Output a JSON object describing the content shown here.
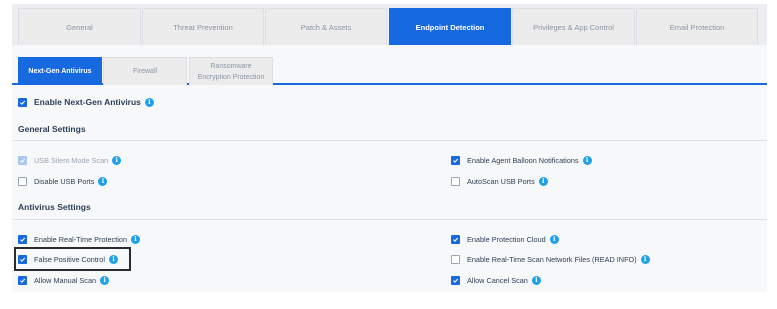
{
  "main_tabs": [
    {
      "label": "General",
      "active": false
    },
    {
      "label": "Threat Prevention",
      "active": false
    },
    {
      "label": "Patch & Assets",
      "active": false
    },
    {
      "label": "Endpoint Detection",
      "active": true
    },
    {
      "label": "Privileges & App Control",
      "active": false
    },
    {
      "label": "Email Protection",
      "active": false
    }
  ],
  "sub_tabs": [
    {
      "label": "Next-Gen Antivirus",
      "active": true
    },
    {
      "label": "Firewall",
      "active": false
    },
    {
      "label": "Ransomware Encryption Protection",
      "active": false
    }
  ],
  "enable_ngav": {
    "label": "Enable Next-Gen Antivirus",
    "checked": true
  },
  "general_settings": {
    "title": "General Settings",
    "left": [
      {
        "label": "USB Silent Mode Scan",
        "checked": true,
        "disabled": true
      },
      {
        "label": "Disable USB Ports",
        "checked": false
      }
    ],
    "right": [
      {
        "label": "Enable Agent Balloon Notifications",
        "checked": true
      },
      {
        "label": "AutoScan USB Ports",
        "checked": false
      }
    ]
  },
  "antivirus_settings": {
    "title": "Antivirus Settings",
    "left": [
      {
        "label": "Enable Real-Time Protection",
        "checked": true
      },
      {
        "label": "False Positive Control",
        "checked": true
      },
      {
        "label": "Allow Manual Scan",
        "checked": true
      }
    ],
    "right": [
      {
        "label": "Enable Protection Cloud",
        "checked": true
      },
      {
        "label": "Enable Real-Time Scan Network Files (READ INFO)",
        "checked": false
      },
      {
        "label": "Allow Cancel Scan",
        "checked": true
      }
    ]
  },
  "colors": {
    "accent": "#1769e0",
    "info": "#1fa0e8",
    "highlight_border": "#2b2b2b"
  },
  "icons": {
    "check": "check-icon",
    "info": "info-icon"
  }
}
